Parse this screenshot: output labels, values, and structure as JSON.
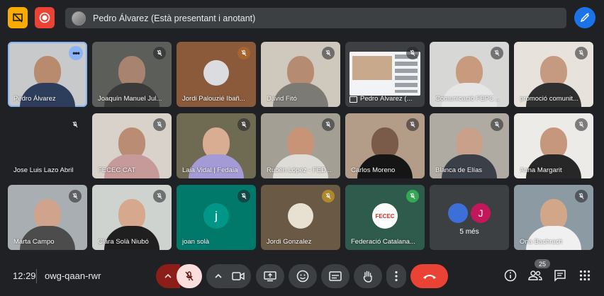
{
  "top": {
    "presenter_text": "Pedro Álvarez (Està presentant i anotant)"
  },
  "tiles": [
    {
      "name": "Pedro Álvarez",
      "bg": "#c8c9ca",
      "skin": "#b88a6e",
      "shirt": "#2d3e5c",
      "active": true,
      "more": true
    },
    {
      "name": "Joaquín Manuel Jul...",
      "bg": "#5c5e5a",
      "skin": "#a88470",
      "shirt": "#3a3a3a",
      "muted": true
    },
    {
      "name": "Jordi Palouzié Ibañ...",
      "bg": "#8a5a3a",
      "avatar": true,
      "avatar_color": "#dadce0",
      "muted": true,
      "mute_color": "#a8642d"
    },
    {
      "name": "David Fitó",
      "bg": "#cfc9bd",
      "skin": "#b58c72",
      "shirt": "#7c7a74",
      "muted": true
    },
    {
      "name": "Pedro Álvarez (...",
      "bg": "#3c4043",
      "screen": true,
      "present_icon": true
    },
    {
      "name": "Comunicació FEPC...",
      "bg": "#d7d8d6",
      "skin": "#c89a7e",
      "shirt": "#e5e5e5",
      "muted": true
    },
    {
      "name": "promoció comunit...",
      "bg": "#e7e3dc",
      "skin": "#c69a80",
      "shirt": "#2f2f2f",
      "muted": true
    },
    {
      "name": "Jose Luis Lazo Abril",
      "bg": "#202124",
      "muted": true,
      "blank": true
    },
    {
      "name": "FECEC CAT",
      "bg": "#d8d2ca",
      "skin": "#b98c73",
      "shirt": "#c79a9a",
      "muted": true
    },
    {
      "name": "Laia Vidal | Fedaia",
      "bg": "#6f6a52",
      "skin": "#d8ad92",
      "shirt": "#a49ad6",
      "muted": true
    },
    {
      "name": "Rubén López - FED...",
      "bg": "#a49f95",
      "skin": "#c79478",
      "shirt": "#dedcd6",
      "muted": true
    },
    {
      "name": "Carlos Moreno",
      "bg": "#b39c88",
      "skin": "#7a5a48",
      "shirt": "#151515",
      "muted": true
    },
    {
      "name": "Blanca de Elías",
      "bg": "#b0aba2",
      "skin": "#c9a08a",
      "shirt": "#3a3f48",
      "muted": true
    },
    {
      "name": "Anna Margarit",
      "bg": "#ecebe8",
      "skin": "#c5987e",
      "shirt": "#272727",
      "muted": true
    },
    {
      "name": "Marta Campo",
      "bg": "#a8aeb1",
      "skin": "#d0a48c",
      "shirt": "#4c4c4c",
      "muted": true
    },
    {
      "name": "Clara Solà Niubó",
      "bg": "#cfd3cf",
      "skin": "#d6a98e",
      "shirt": "#1f1f1f",
      "muted": true
    },
    {
      "name": "joan solà",
      "bg": "#00796b",
      "letter": "j",
      "letter_bg": "#009688",
      "muted": true
    },
    {
      "name": "Jordi Gonzalez",
      "bg": "#6a5a45",
      "avatar": true,
      "avatar_color": "#e8e0d0",
      "muted": true,
      "mute_color": "#b0882c"
    },
    {
      "name": "Federació Catalana...",
      "bg": "#2e5b4c",
      "fecec": true,
      "logo_text": "FECEC",
      "muted": true,
      "mute_color": "#34a853"
    },
    {
      "name": "",
      "bg": "#3c4043",
      "more_tile": true,
      "more_text": "5 més",
      "more_letter": "J"
    },
    {
      "name": "Ona Bachrach",
      "bg": "#8c9aa3",
      "skin": "#d2a688",
      "shirt": "#f0f0f0",
      "muted": true
    }
  ],
  "bottom": {
    "time": "12:29",
    "meeting_code": "owg-qaan-rwr",
    "participants_count": "25"
  },
  "colors": {
    "accent": "#8ab4f8",
    "end_call": "#ea4335",
    "background": "#202124"
  }
}
